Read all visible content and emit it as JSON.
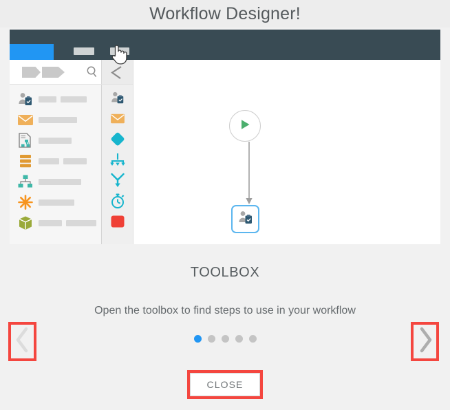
{
  "dialog": {
    "title": "Workflow Designer!",
    "caption_title": "TOOLBOX",
    "caption_text": "Open the toolbox to find steps to use in your workflow",
    "close_label": "CLOSE",
    "prev_icon": "chevron-left-icon",
    "next_icon": "chevron-right-icon",
    "accent_color": "#2196f3",
    "highlight_color": "#f4463f",
    "body_background": "#f1f1f1",
    "header_background": "#ededed"
  },
  "pagination": {
    "total": 5,
    "current": 1,
    "dots": [
      {
        "active": true
      },
      {
        "active": false
      },
      {
        "active": false
      },
      {
        "active": false
      },
      {
        "active": false
      }
    ]
  },
  "screenshot": {
    "navbar": {
      "background": "#394b54",
      "active_tab_color": "#2196f3",
      "placeholders": 2
    },
    "toolbox": {
      "search_icon": "magnifier-icon",
      "collapse_icon": "collapse-left-icon",
      "cursor_icon": "hand-cursor-icon",
      "breadcrumb_icon": "breadcrumb-chevrons",
      "items": [
        {
          "icon": "person-clipboard-icon",
          "color": "#2e5871",
          "lines": [
            26,
            38
          ]
        },
        {
          "icon": "envelope-icon",
          "color": "#efb05a",
          "lines": [
            56
          ]
        },
        {
          "icon": "document-flowchart-icon",
          "color": "#3fb8b0",
          "lines": [
            48
          ]
        },
        {
          "icon": "database-icon",
          "color": "#e09a33",
          "lines": [
            30,
            34
          ]
        },
        {
          "icon": "org-chart-icon",
          "color": "#3fb8a8",
          "lines": [
            62
          ]
        },
        {
          "icon": "asterisk-icon",
          "color": "#f7941e",
          "lines": [
            52
          ]
        },
        {
          "icon": "package-box-icon",
          "color": "#9aaa3a",
          "lines": [
            34,
            44
          ]
        }
      ],
      "rail_items": [
        {
          "icon": "person-clipboard-icon",
          "color": "#2e5871"
        },
        {
          "icon": "envelope-icon",
          "color": "#efb05a"
        },
        {
          "icon": "diamond-decision-icon",
          "color": "#17b5cd"
        },
        {
          "icon": "branch-merge-icon",
          "color": "#17b5cd"
        },
        {
          "icon": "fork-join-icon",
          "color": "#17b5cd"
        },
        {
          "icon": "stopwatch-timer-icon",
          "color": "#17b5cd"
        },
        {
          "icon": "stop-square-icon",
          "color": "#ef4036"
        }
      ]
    },
    "canvas": {
      "start_node_icon": "play-icon",
      "start_node_color": "#4caf6e",
      "connector_icon": "arrow-down-icon",
      "step_node_icon": "person-clipboard-icon",
      "step_node_border": "#5bb6ef"
    }
  }
}
